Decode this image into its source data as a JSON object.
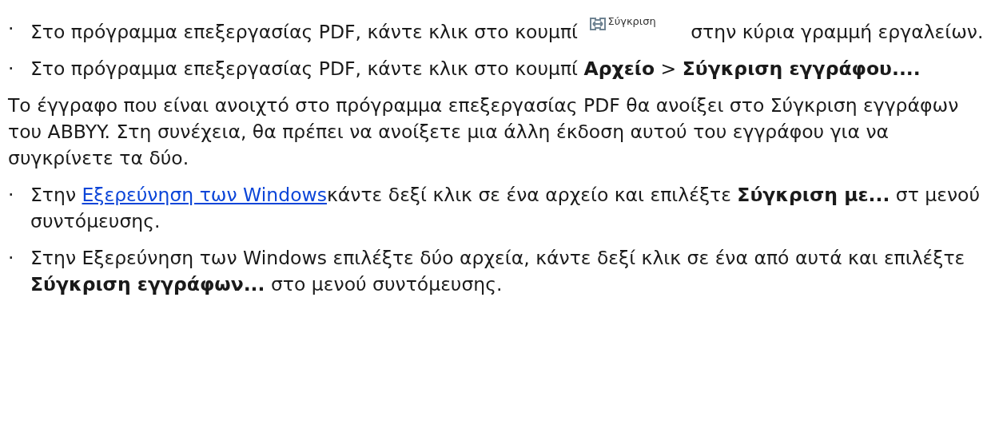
{
  "blocks": [
    {
      "kind": "bullet",
      "bullet": "·",
      "parts": [
        {
          "kind": "text",
          "text": "Στο πρόγραμμα επεξεργασίας PDF, κάντε κλικ στο κουμπί "
        },
        {
          "kind": "button",
          "label": "Σύγκριση"
        },
        {
          "kind": "text",
          "text": " στην κύρια γραμμή εργαλείων."
        }
      ]
    },
    {
      "kind": "bullet",
      "bullet": "·",
      "parts": [
        {
          "kind": "text",
          "text": "Στο πρόγραμμα επεξεργασίας PDF, κάντε κλικ στο κουμπί **Αρχείο** > **Σύγκριση εγγράφου....**"
        }
      ]
    },
    {
      "kind": "paragraph",
      "parts": [
        {
          "kind": "text",
          "text": "Το έγγραφο που είναι ανοιχτό στο πρόγραμμα επεξεργασίας PDF θα ανοίξει στο Σύγκριση εγγράφων του ABBYY. Στη συνέχεια, θα πρέπει να ανοίξετε μια άλλη έκδοση αυτού του εγγράφου για να συγκρίνετε τα δύο."
        }
      ]
    },
    {
      "kind": "bullet",
      "bullet": "·",
      "parts": [
        {
          "kind": "text",
          "text": "Στην "
        },
        {
          "kind": "link",
          "text": "Εξερεύνηση των Windows"
        },
        {
          "kind": "text",
          "text": "κάντε δεξί κλικ σε ένα αρχείο και επιλέξτε **Σύγκριση με...** στ μενού συντόμευσης."
        }
      ]
    },
    {
      "kind": "bullet",
      "bullet": "·",
      "parts": [
        {
          "kind": "text",
          "text": "Στην Εξερεύνηση των Windows επιλέξτε δύο αρχεία, κάντε δεξί κλικ σε ένα από αυτά και επιλέξτε **Σύγκριση εγγράφων...** στο μενού συντόμευσης."
        }
      ]
    }
  ]
}
